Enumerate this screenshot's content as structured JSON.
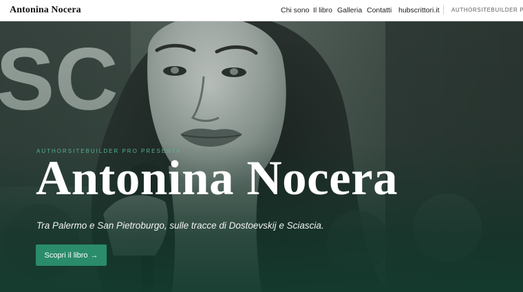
{
  "header": {
    "brand": "Antonina Nocera",
    "nav": [
      {
        "label": "Chi sono"
      },
      {
        "label": "Il libro"
      },
      {
        "label": "Galleria"
      },
      {
        "label": "Contatti"
      },
      {
        "label": "hubscrittori.it"
      }
    ],
    "pro_label": "AUTHORSITEBUILDER PRO"
  },
  "hero": {
    "kicker": "AUTHORSITEBUILDER PRO PRESENTA",
    "title": "Antonina Nocera",
    "tagline": "Tra Palermo e San Pietroburgo, sulle tracce di Dostoevskij e Sciascia.",
    "cta_label": "Scopri il libro",
    "cta_icon": "→",
    "background_text": "SC"
  },
  "colors": {
    "accent": "#2a8c6b",
    "kicker": "#57b291",
    "overlay": "#1d3a2f"
  }
}
